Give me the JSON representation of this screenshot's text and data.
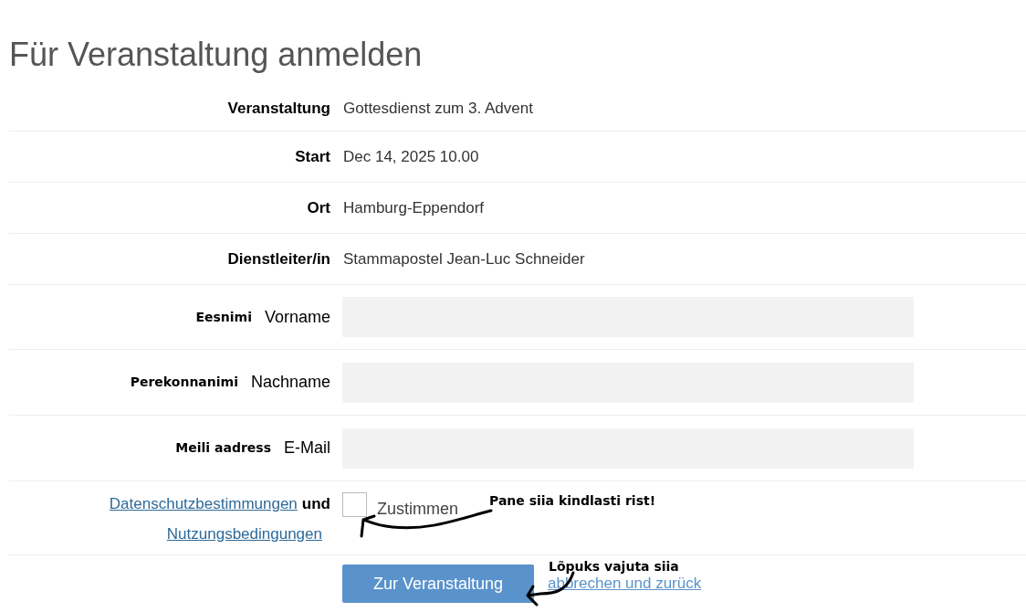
{
  "title": "Für Veranstaltung anmelden",
  "info_rows": [
    {
      "label": "Veranstaltung",
      "value": "Gottesdienst zum 3. Advent"
    },
    {
      "label": "Start",
      "value": "Dec 14, 2025 10.00"
    },
    {
      "label": "Ort",
      "value": "Hamburg-Eppendorf"
    },
    {
      "label": "Dienstleiter/in",
      "value": "Stammapostel Jean-Luc Schneider"
    }
  ],
  "form_fields": [
    {
      "annotation": "Eesnimi",
      "label": "Vorname"
    },
    {
      "annotation": "Perekonnanimi",
      "label": "Nachname"
    },
    {
      "annotation": "Meili aadress",
      "label": "E-Mail"
    }
  ],
  "consent": {
    "link_1": "Datenschutzbestimmungen",
    "joiner": "und",
    "link_2": "Nutzungsbedingungen",
    "checkbox_label": "Zustimmen",
    "checked": false,
    "annotation": "Pane siia kindlasti rist!"
  },
  "actions": {
    "submit": "Zur Veranstaltung",
    "cancel": "abbrechen und zurück",
    "annotation": "Lõpuks vajuta siia"
  }
}
